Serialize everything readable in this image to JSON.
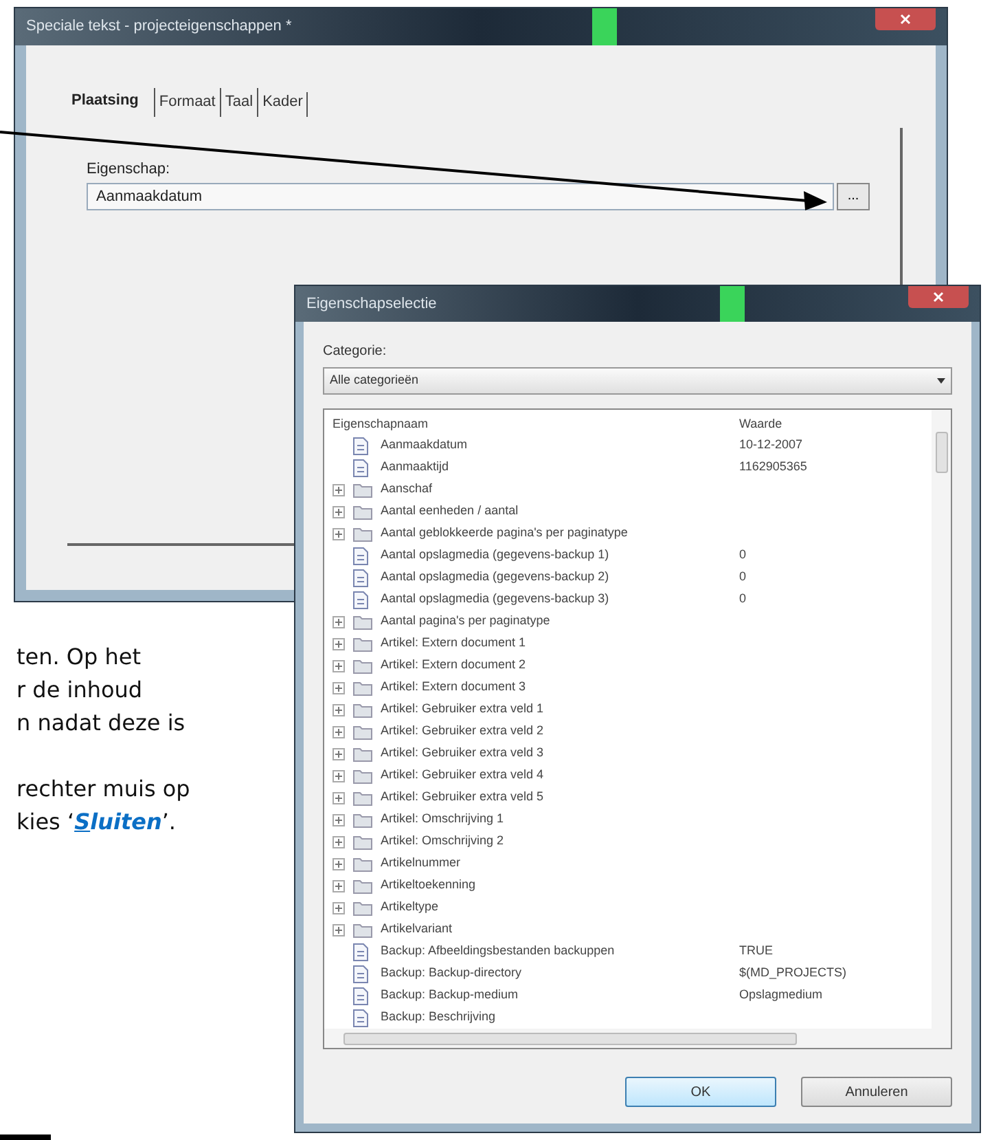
{
  "main_window": {
    "title": "Speciale tekst - projecteigenschappen *",
    "tabs": [
      {
        "label": "Plaatsing",
        "selected": true
      },
      {
        "label": "Formaat",
        "selected": false
      },
      {
        "label": "Taal",
        "selected": false
      },
      {
        "label": "Kader",
        "selected": false
      }
    ],
    "field_label": "Eigenschap:",
    "field_value": "Aanmaakdatum",
    "browse_button": "..."
  },
  "property_dialog": {
    "title": "Eigenschapselectie",
    "category_label": "Categorie:",
    "category_value": "Alle categorieën",
    "columns": [
      "Eigenschapnaam",
      "Waarde"
    ],
    "rows": [
      {
        "kind": "property",
        "name": "Aanmaakdatum",
        "value": "10-12-2007"
      },
      {
        "kind": "property",
        "name": "Aanmaaktijd",
        "value": "1162905365"
      },
      {
        "kind": "group",
        "name": "Aanschaf"
      },
      {
        "kind": "group",
        "name": "Aantal eenheden / aantal"
      },
      {
        "kind": "group",
        "name": "Aantal geblokkeerde pagina's per paginatype"
      },
      {
        "kind": "property",
        "name": "Aantal opslagmedia (gegevens-backup 1)",
        "value": "0"
      },
      {
        "kind": "property",
        "name": "Aantal opslagmedia (gegevens-backup 2)",
        "value": "0"
      },
      {
        "kind": "property",
        "name": "Aantal opslagmedia (gegevens-backup 3)",
        "value": "0"
      },
      {
        "kind": "group",
        "name": "Aantal pagina's per paginatype"
      },
      {
        "kind": "group",
        "name": "Artikel: Extern document 1"
      },
      {
        "kind": "group",
        "name": "Artikel: Extern document 2"
      },
      {
        "kind": "group",
        "name": "Artikel: Extern document 3"
      },
      {
        "kind": "group",
        "name": "Artikel: Gebruiker extra veld 1"
      },
      {
        "kind": "group",
        "name": "Artikel: Gebruiker extra veld 2"
      },
      {
        "kind": "group",
        "name": "Artikel: Gebruiker extra veld 3"
      },
      {
        "kind": "group",
        "name": "Artikel: Gebruiker extra veld 4"
      },
      {
        "kind": "group",
        "name": "Artikel: Gebruiker extra veld 5"
      },
      {
        "kind": "group",
        "name": "Artikel: Omschrijving 1"
      },
      {
        "kind": "group",
        "name": "Artikel: Omschrijving 2"
      },
      {
        "kind": "group",
        "name": "Artikelnummer"
      },
      {
        "kind": "group",
        "name": "Artikeltoekenning"
      },
      {
        "kind": "group",
        "name": "Artikeltype"
      },
      {
        "kind": "group",
        "name": "Artikelvariant"
      },
      {
        "kind": "property",
        "name": "Backup: Afbeeldingsbestanden backuppen",
        "value": "TRUE"
      },
      {
        "kind": "property",
        "name": "Backup: Backup-directory",
        "value": "$(MD_PROJECTS)"
      },
      {
        "kind": "property",
        "name": "Backup: Backup-medium",
        "value": "Opslagmedium"
      },
      {
        "kind": "property",
        "name": "Backup: Beschrijving"
      }
    ],
    "buttons": [
      "OK",
      "Annuleren"
    ]
  },
  "document_text": {
    "lines": [
      "ten. Op het",
      "r de inhoud",
      "n nadat deze is"
    ],
    "second_paragraph": [
      "rechter muis op"
    ],
    "last_line": {
      "before": "kies ‘",
      "link": "Sluiten",
      "after": "’."
    }
  }
}
